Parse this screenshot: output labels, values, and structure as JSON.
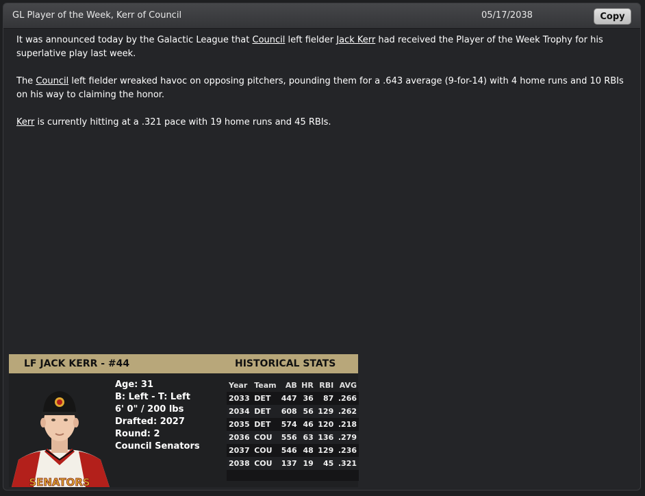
{
  "window": {
    "title": "GL Player of the Week, Kerr of Council",
    "date": "05/17/2038",
    "copy_label": "Copy"
  },
  "article": {
    "p1_a": "It was announced today by the Galactic League that ",
    "p1_team": "Council",
    "p1_b": " left fielder ",
    "p1_player": "Jack Kerr",
    "p1_c": " had received the Player of the Week Trophy for his superlative play last week.",
    "p2_a": "The ",
    "p2_team": "Council",
    "p2_b": " left fielder wreaked havoc on opposing pitchers, pounding them for a .643 average (9-for-14) with 4 home runs and 10 RBIs on his way to claiming the honor.",
    "p3_player": "Kerr",
    "p3_b": " is currently hitting at a .321 pace with 19 home runs and 45 RBIs."
  },
  "card": {
    "player_header": "LF JACK KERR - #44",
    "stats_header": "HISTORICAL STATS",
    "bio": [
      "Age: 31",
      "B: Left - T: Left",
      "6' 0\" / 200 lbs",
      "Drafted: 2027",
      "Round: 2",
      "Council Senators"
    ],
    "jersey_text": "SENATORS",
    "columns": [
      "Year",
      "Team",
      "AB",
      "HR",
      "RBI",
      "AVG"
    ],
    "rows": [
      [
        "2033",
        "DET",
        "447",
        "36",
        "87",
        ".266"
      ],
      [
        "2034",
        "DET",
        "608",
        "56",
        "129",
        ".262"
      ],
      [
        "2035",
        "DET",
        "574",
        "46",
        "120",
        ".218"
      ],
      [
        "2036",
        "COU",
        "556",
        "63",
        "136",
        ".279"
      ],
      [
        "2037",
        "COU",
        "546",
        "48",
        "129",
        ".236"
      ],
      [
        "2038",
        "COU",
        "137",
        "19",
        "45",
        ".321"
      ]
    ]
  },
  "colors": {
    "header_gold": "#b8a77a",
    "background": "#242528"
  }
}
